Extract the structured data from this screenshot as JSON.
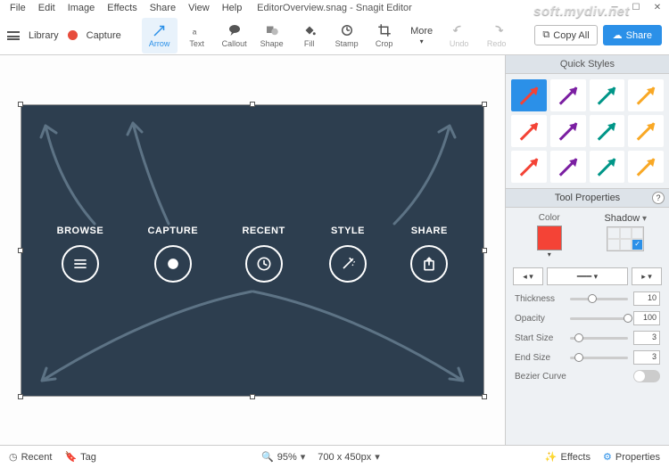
{
  "menu": [
    "File",
    "Edit",
    "Image",
    "Effects",
    "Share",
    "View",
    "Help"
  ],
  "title": "EditorOverview.snag - Snagit Editor",
  "watermark": "soft.mydiv.net",
  "nav": {
    "library": "Library",
    "capture": "Capture"
  },
  "tools": [
    {
      "id": "arrow",
      "label": "Arrow",
      "sel": true
    },
    {
      "id": "text",
      "label": "Text"
    },
    {
      "id": "callout",
      "label": "Callout"
    },
    {
      "id": "shape",
      "label": "Shape"
    },
    {
      "id": "fill",
      "label": "Fill"
    },
    {
      "id": "stamp",
      "label": "Stamp"
    },
    {
      "id": "crop",
      "label": "Crop"
    },
    {
      "id": "more",
      "label": "More"
    }
  ],
  "history": {
    "undo": "Undo",
    "redo": "Redo"
  },
  "actions": {
    "copy": "Copy All",
    "share": "Share"
  },
  "canvas_items": [
    "BROWSE",
    "CAPTURE",
    "RECENT",
    "STYLE",
    "SHARE"
  ],
  "quick_styles": {
    "header": "Quick Styles",
    "colors": [
      "#f44336",
      "#7b1fa2",
      "#009688",
      "#f9a825",
      "#f44336",
      "#7b1fa2",
      "#009688",
      "#f9a825",
      "#f44336",
      "#7b1fa2",
      "#009688",
      "#f9a825"
    ]
  },
  "tool_props": {
    "header": "Tool Properties",
    "color": "Color",
    "shadow": "Shadow",
    "thickness": {
      "label": "Thickness",
      "value": "10"
    },
    "opacity": {
      "label": "Opacity",
      "value": "100"
    },
    "start": {
      "label": "Start Size",
      "value": "3"
    },
    "end": {
      "label": "End Size",
      "value": "3"
    },
    "bezier": "Bezier Curve"
  },
  "status": {
    "recent": "Recent",
    "tag": "Tag",
    "zoom": "95%",
    "dims": "700 x 450px",
    "effects": "Effects",
    "props": "Properties"
  }
}
